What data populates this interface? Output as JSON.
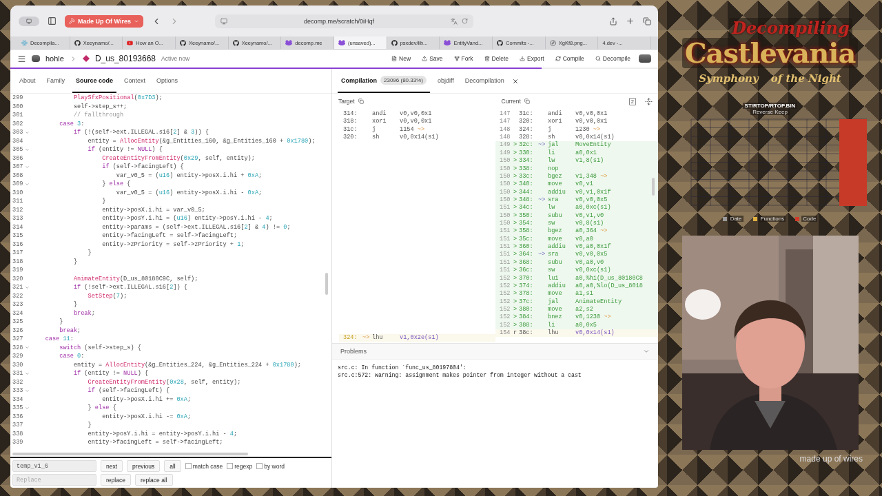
{
  "browser": {
    "tab_group": "Made Up Of Wires",
    "address": "decomp.me/scratch/0iHqf",
    "tabs": [
      {
        "label": "Decompila...",
        "kind": "react",
        "selected": false
      },
      {
        "label": "Xeeynamo/...",
        "kind": "github",
        "selected": false
      },
      {
        "label": "How an O...",
        "kind": "youtube",
        "selected": false
      },
      {
        "label": "Xeeynamo/...",
        "kind": "github",
        "selected": false
      },
      {
        "label": "Xeeynamo/...",
        "kind": "github",
        "selected": false
      },
      {
        "label": "decomp.me",
        "kind": "frog",
        "selected": false
      },
      {
        "label": "(unsaved)...",
        "kind": "frog",
        "selected": true
      },
      {
        "label": "psxdev/lib...",
        "kind": "github",
        "selected": false
      },
      {
        "label": "EntityVand...",
        "kind": "frog",
        "selected": false
      },
      {
        "label": "Commits -...",
        "kind": "github",
        "selected": false
      },
      {
        "label": "XgKf8.png...",
        "kind": "compass",
        "selected": false
      },
      {
        "label": "4.dev -...",
        "kind": "none",
        "selected": false
      }
    ]
  },
  "header": {
    "user": "hohle",
    "scratch": "D_us_80193668",
    "presence": "Active now",
    "actions": [
      {
        "label": "New",
        "kind": "new"
      },
      {
        "label": "Save",
        "kind": "save"
      },
      {
        "label": "Fork",
        "kind": "fork"
      },
      {
        "label": "Delete",
        "kind": "delete"
      },
      {
        "label": "Export",
        "kind": "export"
      },
      {
        "label": "Compile",
        "kind": "compile"
      },
      {
        "label": "Decompile",
        "kind": "decompile"
      }
    ],
    "progress": {
      "level": 0.82
    }
  },
  "source_panel": {
    "tabs": [
      {
        "label": "About",
        "selected": false
      },
      {
        "label": "Family",
        "selected": false
      },
      {
        "label": "Source code",
        "selected": true
      },
      {
        "label": "Context",
        "selected": false
      },
      {
        "label": "Options",
        "selected": false
      }
    ],
    "lines": [
      {
        "n": "299",
        "fold": false,
        "segs": [
          {
            "kind": "fn",
            "text": "            PlaySfxPositional"
          },
          {
            "kind": "tx",
            "text": "("
          },
          {
            "kind": "num",
            "text": "0x7D3"
          },
          {
            "kind": "tx",
            "text": ");"
          }
        ]
      },
      {
        "n": "300",
        "fold": false,
        "segs": [
          {
            "kind": "tx",
            "text": "            self->step_s++;"
          }
        ]
      },
      {
        "n": "301",
        "fold": false,
        "segs": [
          {
            "kind": "cm",
            "text": "            // fallthrough"
          }
        ]
      },
      {
        "n": "302",
        "fold": false,
        "segs": [
          {
            "kind": "kw",
            "text": "        case"
          },
          {
            "kind": "num",
            "text": " 3"
          },
          {
            "kind": "tx",
            "text": ":"
          }
        ]
      },
      {
        "n": "303",
        "fold": true,
        "segs": [
          {
            "kind": "kw",
            "text": "            if"
          },
          {
            "kind": "tx",
            "text": " (!(self->ext.ILLEGAL.s16["
          },
          {
            "kind": "num",
            "text": "2"
          },
          {
            "kind": "tx",
            "text": "] & "
          },
          {
            "kind": "num",
            "text": "3"
          },
          {
            "kind": "tx",
            "text": ")) {"
          }
        ]
      },
      {
        "n": "304",
        "fold": false,
        "segs": [
          {
            "kind": "tx",
            "text": "                entity = "
          },
          {
            "kind": "fn",
            "text": "AllocEntity"
          },
          {
            "kind": "tx",
            "text": "(&g_Entities_160, &g_Entities_160 + "
          },
          {
            "kind": "num",
            "text": "0x1780"
          },
          {
            "kind": "tx",
            "text": ");"
          }
        ]
      },
      {
        "n": "305",
        "fold": true,
        "segs": [
          {
            "kind": "kw",
            "text": "                if"
          },
          {
            "kind": "tx",
            "text": " (entity != "
          },
          {
            "kind": "kw",
            "text": "NULL"
          },
          {
            "kind": "tx",
            "text": ") {"
          }
        ]
      },
      {
        "n": "306",
        "fold": false,
        "segs": [
          {
            "kind": "fn",
            "text": "                    CreateEntityFromEntity"
          },
          {
            "kind": "tx",
            "text": "("
          },
          {
            "kind": "num",
            "text": "0x29"
          },
          {
            "kind": "tx",
            "text": ", self, entity);"
          }
        ]
      },
      {
        "n": "307",
        "fold": true,
        "segs": [
          {
            "kind": "kw",
            "text": "                    if"
          },
          {
            "kind": "tx",
            "text": " (self->facingLeft) {"
          }
        ]
      },
      {
        "n": "308",
        "fold": false,
        "segs": [
          {
            "kind": "tx",
            "text": "                        var_v0_5 = ("
          },
          {
            "kind": "num",
            "text": "u16"
          },
          {
            "kind": "tx",
            "text": ") entity->posX.i.hi + "
          },
          {
            "kind": "num",
            "text": "0xA"
          },
          {
            "kind": "tx",
            "text": ";"
          }
        ]
      },
      {
        "n": "309",
        "fold": true,
        "segs": [
          {
            "kind": "tx",
            "text": "                    } "
          },
          {
            "kind": "kw",
            "text": "else"
          },
          {
            "kind": "tx",
            "text": " {"
          }
        ]
      },
      {
        "n": "310",
        "fold": false,
        "segs": [
          {
            "kind": "tx",
            "text": "                        var_v0_5 = ("
          },
          {
            "kind": "num",
            "text": "u16"
          },
          {
            "kind": "tx",
            "text": ") entity->posX.i.hi - "
          },
          {
            "kind": "num",
            "text": "0xA"
          },
          {
            "kind": "tx",
            "text": ";"
          }
        ]
      },
      {
        "n": "311",
        "fold": false,
        "segs": [
          {
            "kind": "tx",
            "text": "                    }"
          }
        ]
      },
      {
        "n": "312",
        "fold": false,
        "segs": [
          {
            "kind": "tx",
            "text": "                    entity->posX.i.hi = var_v0_5;"
          }
        ]
      },
      {
        "n": "313",
        "fold": false,
        "segs": [
          {
            "kind": "tx",
            "text": "                    entity->posY.i.hi = ("
          },
          {
            "kind": "num",
            "text": "u16"
          },
          {
            "kind": "tx",
            "text": ") entity->posY.i.hi - "
          },
          {
            "kind": "num",
            "text": "4"
          },
          {
            "kind": "tx",
            "text": ";"
          }
        ]
      },
      {
        "n": "314",
        "fold": false,
        "segs": [
          {
            "kind": "tx",
            "text": "                    entity->params = (self->ext.ILLEGAL.s16["
          },
          {
            "kind": "num",
            "text": "2"
          },
          {
            "kind": "tx",
            "text": "] & "
          },
          {
            "kind": "num",
            "text": "4"
          },
          {
            "kind": "tx",
            "text": ") != "
          },
          {
            "kind": "num",
            "text": "0"
          },
          {
            "kind": "tx",
            "text": ";"
          }
        ]
      },
      {
        "n": "315",
        "fold": false,
        "segs": [
          {
            "kind": "tx",
            "text": "                    entity->facingLeft = self->facingLeft;"
          }
        ]
      },
      {
        "n": "316",
        "fold": false,
        "segs": [
          {
            "kind": "tx",
            "text": "                    entity->zPriority = self->zPriority + "
          },
          {
            "kind": "num",
            "text": "1"
          },
          {
            "kind": "tx",
            "text": ";"
          }
        ]
      },
      {
        "n": "317",
        "fold": false,
        "segs": [
          {
            "kind": "tx",
            "text": "                }"
          }
        ]
      },
      {
        "n": "318",
        "fold": false,
        "segs": [
          {
            "kind": "tx",
            "text": "            }"
          }
        ]
      },
      {
        "n": "319",
        "fold": false
      },
      {
        "n": "320",
        "fold": false,
        "segs": [
          {
            "kind": "fn",
            "text": "            AnimateEntity"
          },
          {
            "kind": "tx",
            "text": "(D_us_80180C9C, self);"
          }
        ]
      },
      {
        "n": "321",
        "fold": true,
        "segs": [
          {
            "kind": "kw",
            "text": "            if"
          },
          {
            "kind": "tx",
            "text": " (!self->ext.ILLEGAL.s16["
          },
          {
            "kind": "num",
            "text": "2"
          },
          {
            "kind": "tx",
            "text": "]) {"
          }
        ]
      },
      {
        "n": "322",
        "fold": false,
        "segs": [
          {
            "kind": "fn",
            "text": "                SetStep"
          },
          {
            "kind": "tx",
            "text": "("
          },
          {
            "kind": "num",
            "text": "7"
          },
          {
            "kind": "tx",
            "text": ");"
          }
        ]
      },
      {
        "n": "323",
        "fold": false,
        "segs": [
          {
            "kind": "tx",
            "text": "            }"
          }
        ]
      },
      {
        "n": "324",
        "fold": false,
        "segs": [
          {
            "kind": "kw",
            "text": "            break"
          },
          {
            "kind": "tx",
            "text": ";"
          }
        ]
      },
      {
        "n": "325",
        "fold": false,
        "segs": [
          {
            "kind": "tx",
            "text": "        }"
          }
        ]
      },
      {
        "n": "326",
        "fold": false,
        "segs": [
          {
            "kind": "kw",
            "text": "        break"
          },
          {
            "kind": "tx",
            "text": ";"
          }
        ]
      },
      {
        "n": "327",
        "fold": false,
        "segs": [
          {
            "kind": "kw",
            "text": "    case"
          },
          {
            "kind": "num",
            "text": " 11"
          },
          {
            "kind": "tx",
            "text": ":"
          }
        ]
      },
      {
        "n": "328",
        "fold": true,
        "segs": [
          {
            "kind": "kw",
            "text": "        switch"
          },
          {
            "kind": "tx",
            "text": " (self->step_s) {"
          }
        ]
      },
      {
        "n": "329",
        "fold": false,
        "segs": [
          {
            "kind": "kw",
            "text": "        case"
          },
          {
            "kind": "num",
            "text": " 0"
          },
          {
            "kind": "tx",
            "text": ":"
          }
        ]
      },
      {
        "n": "330",
        "fold": false,
        "segs": [
          {
            "kind": "tx",
            "text": "            entity = "
          },
          {
            "kind": "fn",
            "text": "AllocEntity"
          },
          {
            "kind": "tx",
            "text": "(&g_Entities_224, &g_Entities_224 + "
          },
          {
            "kind": "num",
            "text": "0x1780"
          },
          {
            "kind": "tx",
            "text": ");"
          }
        ]
      },
      {
        "n": "331",
        "fold": true,
        "segs": [
          {
            "kind": "kw",
            "text": "            if"
          },
          {
            "kind": "tx",
            "text": " (entity != "
          },
          {
            "kind": "kw",
            "text": "NULL"
          },
          {
            "kind": "tx",
            "text": ") {"
          }
        ]
      },
      {
        "n": "332",
        "fold": false,
        "segs": [
          {
            "kind": "fn",
            "text": "                CreateEntityFromEntity"
          },
          {
            "kind": "tx",
            "text": "("
          },
          {
            "kind": "num",
            "text": "0x28"
          },
          {
            "kind": "tx",
            "text": ", self, entity);"
          }
        ]
      },
      {
        "n": "333",
        "fold": true,
        "segs": [
          {
            "kind": "kw",
            "text": "                if"
          },
          {
            "kind": "tx",
            "text": " (self->facingLeft) {"
          }
        ]
      },
      {
        "n": "334",
        "fold": false,
        "segs": [
          {
            "kind": "tx",
            "text": "                    entity->posX.i.hi += "
          },
          {
            "kind": "num",
            "text": "0xA"
          },
          {
            "kind": "tx",
            "text": ";"
          }
        ]
      },
      {
        "n": "335",
        "fold": true,
        "segs": [
          {
            "kind": "tx",
            "text": "                } "
          },
          {
            "kind": "kw",
            "text": "else"
          },
          {
            "kind": "tx",
            "text": " {"
          }
        ]
      },
      {
        "n": "336",
        "fold": false,
        "segs": [
          {
            "kind": "tx",
            "text": "                    entity->posX.i.hi -= "
          },
          {
            "kind": "num",
            "text": "0xA"
          },
          {
            "kind": "tx",
            "text": ";"
          }
        ]
      },
      {
        "n": "337",
        "fold": false,
        "segs": [
          {
            "kind": "tx",
            "text": "                }"
          }
        ]
      },
      {
        "n": "338",
        "fold": false,
        "segs": [
          {
            "kind": "tx",
            "text": "                entity->posY.i.hi = entity->posY.i.hi - "
          },
          {
            "kind": "num",
            "text": "4"
          },
          {
            "kind": "tx",
            "text": ";"
          }
        ]
      },
      {
        "n": "339",
        "fold": false,
        "segs": [
          {
            "kind": "tx",
            "text": "                entity->facingLeft = self->facingLeft;"
          }
        ]
      }
    ],
    "find": {
      "query": "temp_v1_6",
      "replace_placeholder": "Replace",
      "buttons": [
        "next",
        "previous",
        "all"
      ],
      "options": [
        {
          "label": "match case",
          "checked": false
        },
        {
          "label": "regexp",
          "checked": false
        },
        {
          "label": "by word",
          "checked": false
        }
      ],
      "replace_buttons": [
        "replace",
        "replace all"
      ]
    }
  },
  "compilation_panel": {
    "tabs": [
      {
        "label": "Compilation",
        "badge": "23096 (80.33%)",
        "selected": true
      },
      {
        "label": "objdiff",
        "selected": false
      },
      {
        "label": "Decompilation",
        "selected": false
      }
    ],
    "target": {
      "title": "Target",
      "rows": [
        {
          "addr": "314:",
          "op": "andi",
          "args": "v0,v0,0x1",
          "kind": "same"
        },
        {
          "addr": "318:",
          "op": "xori",
          "args": "v0,v0,0x1",
          "kind": "same"
        },
        {
          "addr": "31c:",
          "op": "j",
          "args": "1154",
          "jump_out": "~>",
          "kind": "same"
        },
        {
          "addr": "320:",
          "op": "sh",
          "args": "v0,0x14(s1)",
          "kind": "same"
        }
      ],
      "tail_rows": [
        {
          "addr": "324:",
          "jump_in": "~>",
          "op": "lhu",
          "args": "v1,0x2e(s1)",
          "kind": "replace"
        }
      ]
    },
    "current": {
      "title": "Current",
      "columns_badge": "2",
      "rows": [
        {
          "src": "147",
          "addr": "31c:",
          "op": "andi",
          "args": "v0,v0,0x1",
          "kind": "same"
        },
        {
          "src": "147",
          "addr": "320:",
          "op": "xori",
          "args": "v0,v0,0x1",
          "kind": "same"
        },
        {
          "src": "148",
          "addr": "324:",
          "op": "j",
          "args": "1230",
          "jump_out": "~>",
          "kind": "same"
        },
        {
          "src": "148",
          "addr": "328:",
          "op": "sh",
          "args": "v0,0x14(s1)",
          "kind": "same"
        },
        {
          "src": "149",
          "mark": ">",
          "addr": "32c:",
          "jump_in": "~>",
          "op": "jal",
          "args": "MoveEntity",
          "kind": "insert"
        },
        {
          "src": "149",
          "mark": ">",
          "addr": "330:",
          "op": "li",
          "args": "a0,0x1",
          "kind": "insert"
        },
        {
          "src": "150",
          "mark": ">",
          "addr": "334:",
          "op": "lw",
          "args": "v1,8(s1)",
          "kind": "insert"
        },
        {
          "src": "150",
          "mark": ">",
          "addr": "338:",
          "op": "nop",
          "kind": "insert"
        },
        {
          "src": "150",
          "mark": ">",
          "addr": "33c:",
          "op": "bgez",
          "args": "v1,348",
          "jump_out": "~>",
          "kind": "insert"
        },
        {
          "src": "150",
          "mark": ">",
          "addr": "340:",
          "op": "move",
          "args": "v0,v1",
          "kind": "insert"
        },
        {
          "src": "150",
          "mark": ">",
          "addr": "344:",
          "op": "addiu",
          "args": "v0,v1,0x1f",
          "kind": "insert"
        },
        {
          "src": "150",
          "mark": ">",
          "addr": "348:",
          "jump_in": "~>",
          "op": "sra",
          "args": "v0,v0,0x5",
          "kind": "insert"
        },
        {
          "src": "151",
          "mark": ">",
          "addr": "34c:",
          "op": "lw",
          "args": "a0,0xc(s1)",
          "kind": "insert"
        },
        {
          "src": "150",
          "mark": ">",
          "addr": "350:",
          "op": "subu",
          "args": "v0,v1,v0",
          "kind": "insert"
        },
        {
          "src": "150",
          "mark": ">",
          "addr": "354:",
          "op": "sw",
          "args": "v0,8(s1)",
          "kind": "insert"
        },
        {
          "src": "151",
          "mark": ">",
          "addr": "358:",
          "op": "bgez",
          "args": "a0,364",
          "jump_out": "~>",
          "kind": "insert"
        },
        {
          "src": "151",
          "mark": ">",
          "addr": "35c:",
          "op": "move",
          "args": "v0,a0",
          "kind": "insert"
        },
        {
          "src": "151",
          "mark": ">",
          "addr": "360:",
          "op": "addiu",
          "args": "v0,a0,0x1f",
          "kind": "insert"
        },
        {
          "src": "151",
          "mark": ">",
          "addr": "364:",
          "jump_in": "~>",
          "op": "sra",
          "args": "v0,v0,0x5",
          "kind": "insert"
        },
        {
          "src": "151",
          "mark": ">",
          "addr": "368:",
          "op": "subu",
          "args": "v0,a0,v0",
          "kind": "insert"
        },
        {
          "src": "151",
          "mark": ">",
          "addr": "36c:",
          "op": "sw",
          "args": "v0,0xc(s1)",
          "kind": "insert"
        },
        {
          "src": "152",
          "mark": ">",
          "addr": "370:",
          "op": "lui",
          "args": "a0,%hi(D_us_80180C8",
          "kind": "insert"
        },
        {
          "src": "152",
          "mark": ">",
          "addr": "374:",
          "op": "addiu",
          "args": "a0,a0,%lo(D_us_8018",
          "kind": "insert"
        },
        {
          "src": "152",
          "mark": ">",
          "addr": "378:",
          "op": "move",
          "args": "a1,s1",
          "kind": "insert"
        },
        {
          "src": "152",
          "mark": ">",
          "addr": "37c:",
          "op": "jal",
          "args": "AnimateEntity",
          "kind": "insert"
        },
        {
          "src": "152",
          "mark": ">",
          "addr": "380:",
          "op": "move",
          "args": "a2,s2",
          "kind": "insert"
        },
        {
          "src": "152",
          "mark": ">",
          "addr": "384:",
          "op": "bnez",
          "args": "v0,1230",
          "jump_out": "~>",
          "kind": "insert"
        },
        {
          "src": "152",
          "mark": ">",
          "addr": "388:",
          "op": "li",
          "args": "a0,0x5",
          "kind": "insert"
        },
        {
          "src": "154",
          "mark": "r",
          "addr": "38c:",
          "op": "lhu",
          "args": "v0,0x14(s1)",
          "kind": "replace"
        }
      ]
    },
    "problems": {
      "title": "Problems",
      "messages": [
        "src.c: In function `func_us_80197804':",
        "src.c:572: warning: assignment makes pointer from integer without a cast"
      ]
    }
  },
  "overlay": {
    "title": {
      "kicker": "Decompiling",
      "main": "Castlevania",
      "sub_left": "Symphony",
      "sub_right": "of the Night"
    },
    "chart": {
      "title": "ST/RTOP/RTOP.BIN",
      "subtitle": "Reverse Keep",
      "legend": [
        {
          "label": "Date",
          "color": "#9a9a9a"
        },
        {
          "label": "Functions",
          "color": "#e0b040"
        },
        {
          "label": "Code",
          "color": "#d03a2a"
        }
      ]
    },
    "caption": "made up of wires"
  }
}
